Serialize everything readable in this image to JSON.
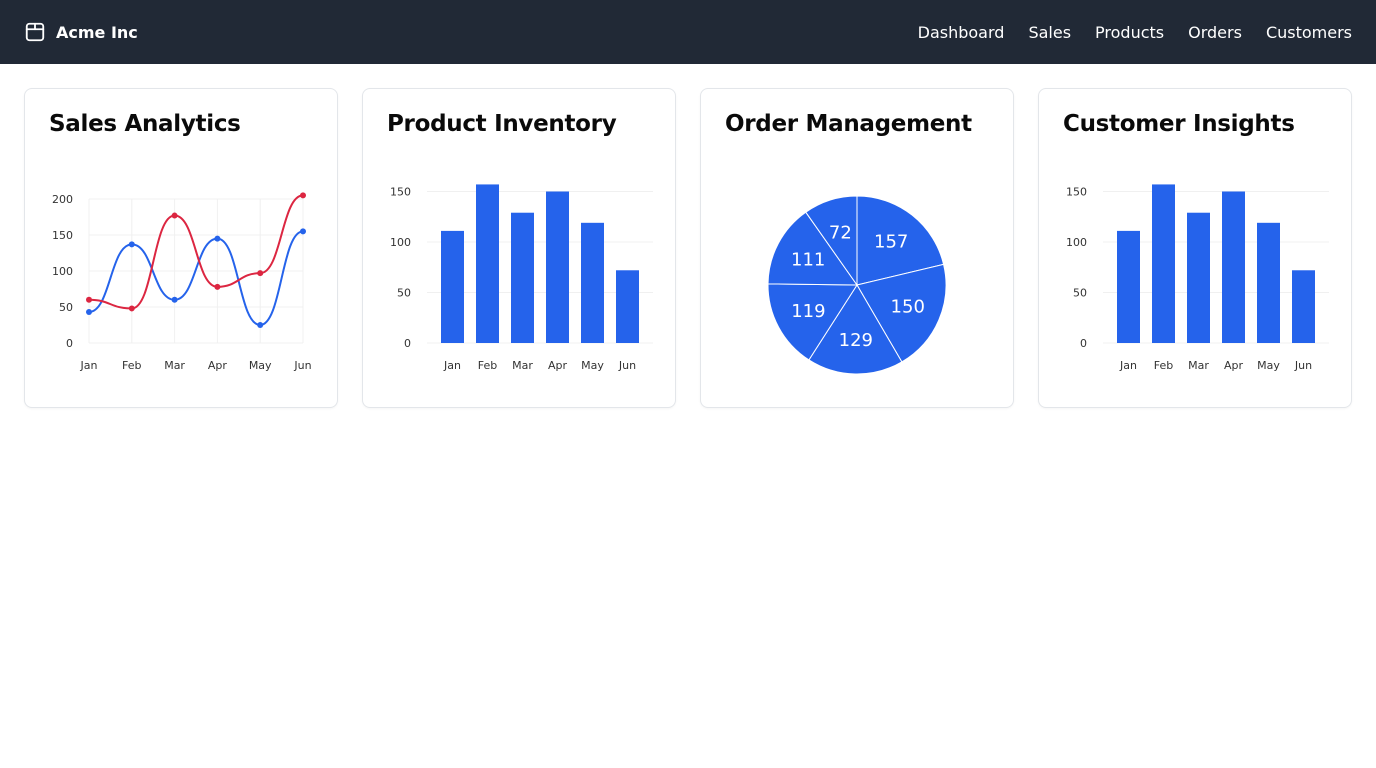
{
  "header": {
    "brand": "Acme Inc",
    "brand_icon": "package-icon",
    "nav": [
      "Dashboard",
      "Sales",
      "Products",
      "Orders",
      "Customers"
    ]
  },
  "colors": {
    "primary": "#2563eb",
    "secondary": "#dc2641",
    "header_bg": "#212936"
  },
  "cards": [
    {
      "title": "Sales Analytics"
    },
    {
      "title": "Product Inventory"
    },
    {
      "title": "Order Management"
    },
    {
      "title": "Customer Insights"
    }
  ],
  "chart_data": [
    {
      "type": "line",
      "categories": [
        "Jan",
        "Feb",
        "Mar",
        "Apr",
        "May",
        "Jun"
      ],
      "ylim": [
        0,
        200
      ],
      "yticks": [
        0,
        50,
        100,
        150,
        200
      ],
      "grid": true,
      "series": [
        {
          "values": [
            43,
            137,
            60,
            145,
            25,
            155
          ],
          "color": "#2563eb"
        },
        {
          "values": [
            60,
            48,
            177,
            78,
            97,
            205
          ],
          "color": "#dc2641"
        }
      ]
    },
    {
      "type": "bar",
      "categories": [
        "Jan",
        "Feb",
        "Mar",
        "Apr",
        "May",
        "Jun"
      ],
      "values": [
        111,
        157,
        129,
        150,
        119,
        72
      ],
      "ylim": [
        0,
        160
      ],
      "yticks": [
        0,
        50,
        100,
        150
      ],
      "color": "#2563eb"
    },
    {
      "type": "pie",
      "values": [
        157,
        150,
        129,
        119,
        111,
        72
      ],
      "labels": [
        "157",
        "150",
        "129",
        "119",
        "111",
        "72"
      ],
      "color": "#2563eb"
    },
    {
      "type": "bar",
      "categories": [
        "Jan",
        "Feb",
        "Mar",
        "Apr",
        "May",
        "Jun"
      ],
      "values": [
        111,
        157,
        129,
        150,
        119,
        72
      ],
      "ylim": [
        0,
        160
      ],
      "yticks": [
        0,
        50,
        100,
        150
      ],
      "color": "#2563eb"
    }
  ]
}
